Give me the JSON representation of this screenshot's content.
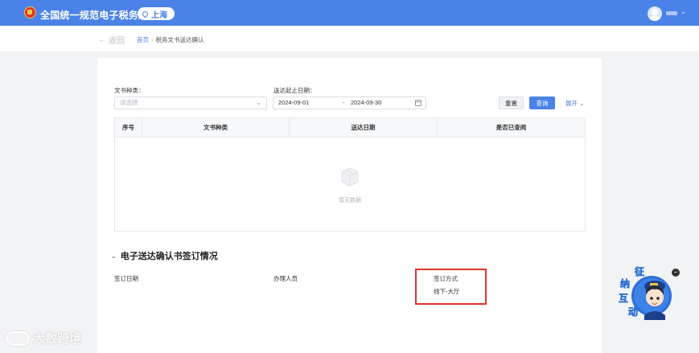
{
  "header": {
    "site_title": "全国统一规范电子税务局",
    "region": "上海",
    "user_caret": "⌄"
  },
  "nav": {
    "back_label": "返回",
    "breadcrumb_home": "首页",
    "breadcrumb_sep": "›",
    "breadcrumb_current": "税务文书送达确认"
  },
  "filters": {
    "doc_type_label": "文书种类：",
    "doc_type_placeholder": "请选择",
    "date_range_label": "送达起止日期：",
    "date_start": "2024-09-01",
    "date_dash": "-",
    "date_end": "2024-09-30",
    "reset_label": "重置",
    "query_label": "查询",
    "expand_label": "展开 ⌄"
  },
  "table": {
    "columns": [
      "序号",
      "文书种类",
      "送达日期",
      "是否已查阅"
    ],
    "rows": [],
    "empty_text": "暂无数据"
  },
  "signing": {
    "section_title": "电子送达确认书签订情况",
    "fields": [
      {
        "label": "签订日期",
        "value": ""
      },
      {
        "label": "办理人员",
        "value": ""
      },
      {
        "label": "签订方式",
        "value": "线下-大厅"
      }
    ]
  },
  "assistant": {
    "chars": [
      "征",
      "纳",
      "互",
      "动"
    ],
    "close_icon": "−"
  },
  "watermark": {
    "text": "大数跨境"
  },
  "colors": {
    "primary": "#4a82e8",
    "highlight": "#e0342b",
    "background": "#f2f3f5"
  }
}
